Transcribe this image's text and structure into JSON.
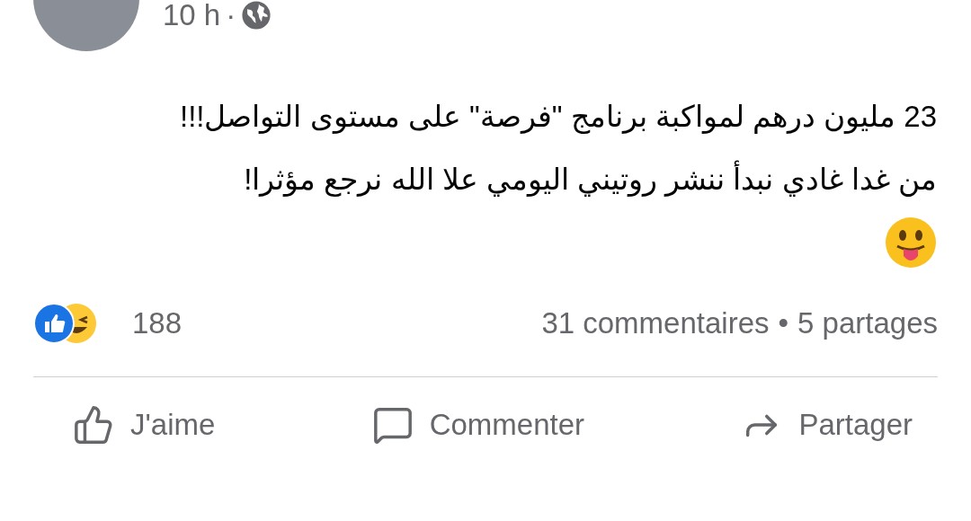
{
  "post": {
    "time": "10 h",
    "separator": "·",
    "paragraphs": [
      "23 مليون درهم لمواكبة برنامج \"فرصة\" على مستوى التواصل!!!",
      "من غدا غادي نبدأ ننشر روتيني اليومي علا الله نرجع مؤثرا!"
    ]
  },
  "stats": {
    "reactions_count": "188",
    "comments": "31 commentaires",
    "dot": "•",
    "shares": "5 partages"
  },
  "actions": [
    {
      "kind": "like",
      "label": "J'aime"
    },
    {
      "kind": "comment",
      "label": "Commenter"
    },
    {
      "kind": "share",
      "label": "Partager"
    }
  ]
}
